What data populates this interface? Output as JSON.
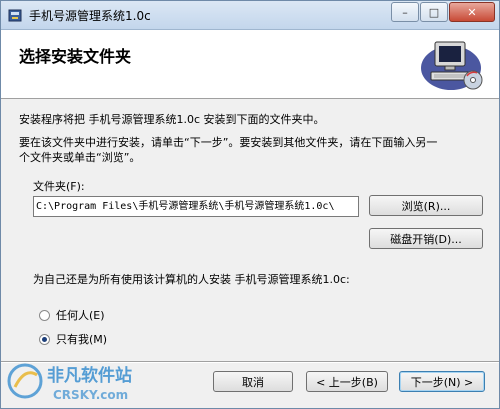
{
  "window": {
    "title": "手机号源管理系统1.0c",
    "minimize_glyph": "–",
    "maximize_glyph": "□",
    "close_glyph": "✕"
  },
  "banner": {
    "title": "选择安装文件夹"
  },
  "body": {
    "intro": "安装程序将把 手机号源管理系统1.0c 安装到下面的文件夹中。",
    "instructions_line1": "要在该文件夹中进行安装，请单击“下一步”。要安装到其他文件夹，请在下面输入另一",
    "instructions_line2": "个文件夹或单击“浏览”。"
  },
  "folder": {
    "label": "文件夹(F):",
    "path": "C:\\Program Files\\手机号源管理系统\\手机号源管理系统1.0c\\",
    "browse_label": "浏览(R)...",
    "disk_cost_label": "磁盘开销(D)..."
  },
  "install_for": {
    "question": "为自己还是为所有使用该计算机的人安装 手机号源管理系统1.0c:",
    "options": [
      {
        "label": "任何人(E)",
        "checked": false
      },
      {
        "label": "只有我(M)",
        "checked": true
      }
    ]
  },
  "footer": {
    "cancel_label": "取消",
    "back_label": "< 上一步(B)",
    "next_label": "下一步(N) >"
  },
  "watermark": {
    "text_cn": "非凡软件站",
    "text_en": "CRSKY.com"
  },
  "colors": {
    "accent": "#3c7fb1",
    "watermark": "#3a8fd0"
  }
}
